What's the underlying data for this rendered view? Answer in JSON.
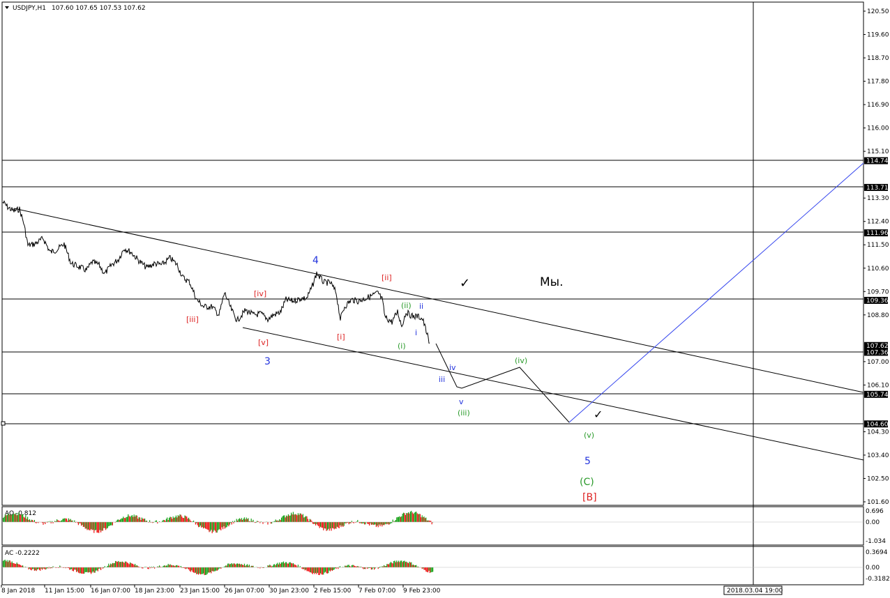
{
  "window": {
    "symbol_label": "USDJPY,H1",
    "ohlc": "107.60 107.65 107.53 107.62"
  },
  "price_axis": {
    "ticks": [
      "120.50",
      "119.60",
      "118.70",
      "117.80",
      "116.90",
      "116.00",
      "115.10",
      "113.30",
      "112.40",
      "111.50",
      "110.60",
      "109.70",
      "108.80",
      "107.00",
      "106.10",
      "104.30",
      "103.40",
      "102.50",
      "101.60"
    ],
    "level_boxes": [
      "114.74",
      "113.71",
      "111.96",
      "109.36",
      "107.62",
      "107.36",
      "105.74",
      "104.60"
    ]
  },
  "time_axis": {
    "labels": [
      "8 Jan 2018",
      "11 Jan 15:00",
      "16 Jan 07:00",
      "18 Jan 23:00",
      "23 Jan 15:00",
      "26 Jan 07:00",
      "30 Jan 23:00",
      "2 Feb 15:00",
      "7 Feb 07:00",
      "9 Feb 23:00"
    ],
    "cursor_label": "2018.03.04 19:00"
  },
  "wave_labels": {
    "blue": [
      "4",
      "3",
      "5",
      "ii",
      "i",
      "iv",
      "iii",
      "v"
    ],
    "red": [
      "[ii]",
      "[iv]",
      "[iii]",
      "[v]",
      "[i]",
      "[B]"
    ],
    "green": [
      "(ii)",
      "(i)",
      "(iv)",
      "(iii)",
      "(v)",
      "(C)"
    ]
  },
  "annotations": {
    "comment": "Мы.",
    "check": "✓"
  },
  "indicators": {
    "ao": {
      "label": "AO -0.812",
      "ticks": [
        "0.696",
        "0.00",
        "-1.034"
      ]
    },
    "ac": {
      "label": "AC -0.2222",
      "ticks": [
        "0.3694",
        "0.00",
        "-0.3182"
      ]
    }
  },
  "colors": {
    "bull": "#12a012",
    "bear": "#ee1111",
    "wave_blue": "#2233dd",
    "wave_red": "#dd2222",
    "wave_green": "#2a9a2a",
    "channel_blue": "#3344ee"
  }
}
